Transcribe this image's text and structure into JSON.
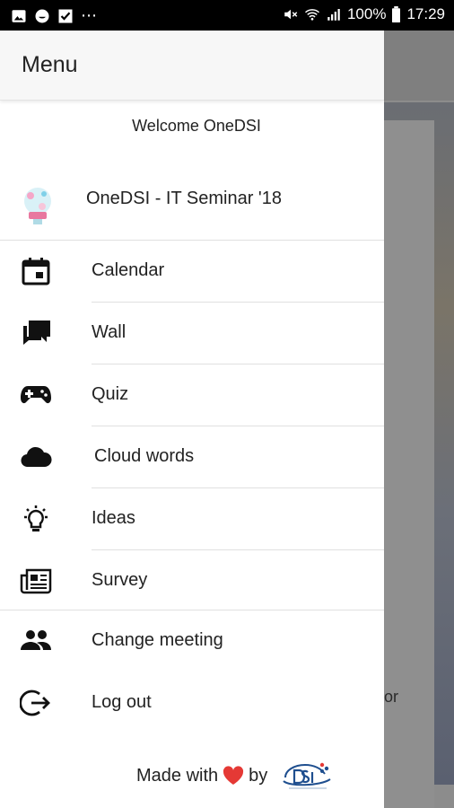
{
  "status_bar": {
    "battery": "100%",
    "time": "17:29"
  },
  "drawer": {
    "title": "Menu",
    "welcome": "Welcome OneDSI",
    "event": {
      "name": "OneDSI - IT Seminar '18"
    },
    "items": [
      {
        "label": "Calendar",
        "icon": "calendar-icon"
      },
      {
        "label": "Wall",
        "icon": "chat-icon"
      },
      {
        "label": "Quiz",
        "icon": "gamepad-icon"
      },
      {
        "label": "Cloud words",
        "icon": "cloud-icon"
      },
      {
        "label": "Ideas",
        "icon": "lightbulb-icon"
      },
      {
        "label": "Survey",
        "icon": "newspaper-icon"
      },
      {
        "label": "Change meeting",
        "icon": "people-icon"
      },
      {
        "label": "Log out",
        "icon": "logout-icon"
      }
    ],
    "footer": {
      "made_with": "Made with",
      "by": "by"
    }
  },
  "backdrop": {
    "text": "or"
  },
  "colors": {
    "heart": "#e53935",
    "dsi_blue": "#1f4f8f"
  }
}
